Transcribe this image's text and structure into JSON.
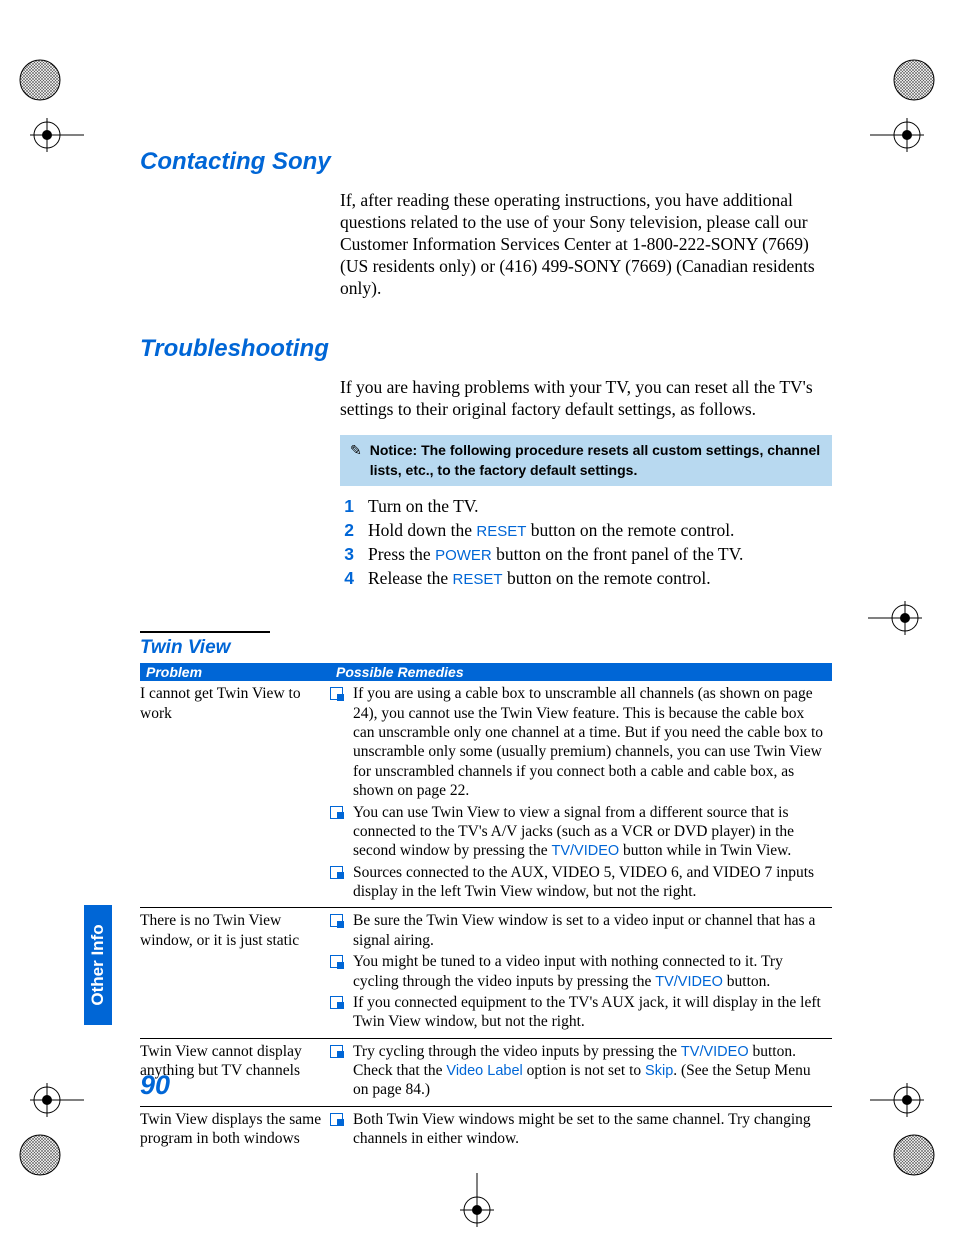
{
  "page_number": "90",
  "side_tab": "Other Info",
  "sections": {
    "contacting": {
      "title": "Contacting Sony",
      "body": "If, after reading these operating instructions, you have additional questions related to the use of your Sony television, please call our Customer Information Services Center at 1-800-222-SONY (7669) (US residents only) or (416) 499-SONY (7669) (Canadian residents only)."
    },
    "troubleshooting": {
      "title": "Troubleshooting",
      "body": "If you are having problems with your TV, you can reset all the TV's settings to their original factory default settings, as follows.",
      "notice": "Notice: The following procedure resets all custom settings, channel lists, etc., to the factory default settings.",
      "steps": [
        {
          "n": "1",
          "pre": "Turn on the TV.",
          "term": "",
          "post": ""
        },
        {
          "n": "2",
          "pre": "Hold down the ",
          "term": "RESET",
          "post": " button on the remote control."
        },
        {
          "n": "3",
          "pre": "Press the ",
          "term": "POWER",
          "post": " button on the front panel of the TV."
        },
        {
          "n": "4",
          "pre": "Release the ",
          "term": "RESET",
          "post": " button on the remote control."
        }
      ]
    }
  },
  "twin_view": {
    "title": "Twin View",
    "headers": {
      "problem": "Problem",
      "remedies": "Possible Remedies"
    },
    "rows": [
      {
        "problem": "I cannot get Twin View to work",
        "remedies": [
          {
            "parts": [
              {
                "t": "If you are using a cable box to unscramble all channels (as shown on page 24), you cannot use the Twin View feature. This is because the cable box can unscramble only one channel at a time. But if you need the cable box to unscramble only some (usually premium) channels, you can use Twin View for unscrambled channels if you connect both a cable and cable box, as shown on page 22."
              }
            ]
          },
          {
            "parts": [
              {
                "t": "You can use Twin View to view a signal from a different source that is connected to the TV's A/V jacks (such as a VCR or DVD player) in the second window by pressing the "
              },
              {
                "term": "TV/VIDEO"
              },
              {
                "t": " button while in Twin View."
              }
            ]
          },
          {
            "parts": [
              {
                "t": "Sources connected to the AUX, VIDEO 5, VIDEO 6, and VIDEO 7 inputs display in the left Twin View window, but not the right."
              }
            ]
          }
        ]
      },
      {
        "problem": "There is no Twin View window, or it is just static",
        "remedies": [
          {
            "parts": [
              {
                "t": "Be sure the Twin View window is set to a video input or channel that has a signal airing."
              }
            ]
          },
          {
            "parts": [
              {
                "t": "You might be tuned to a video input with nothing connected to it. Try cycling through the video inputs by pressing the "
              },
              {
                "term": "TV/VIDEO"
              },
              {
                "t": " button."
              }
            ]
          },
          {
            "parts": [
              {
                "t": "If you connected equipment to the TV's AUX jack, it will display in the left Twin View window, but not the right."
              }
            ]
          }
        ]
      },
      {
        "problem": "Twin View cannot display anything but TV channels",
        "remedies": [
          {
            "parts": [
              {
                "t": "Try cycling through the video inputs by pressing the "
              },
              {
                "term": "TV/VIDEO"
              },
              {
                "t": " button. Check that the "
              },
              {
                "term": "Video Label"
              },
              {
                "t": " option is not set to "
              },
              {
                "term": "Skip"
              },
              {
                "t": ". (See the Setup Menu on page 84.)"
              }
            ]
          }
        ]
      },
      {
        "problem": "Twin View displays the same program in both windows",
        "remedies": [
          {
            "parts": [
              {
                "t": "Both Twin View windows might be set to the same channel. Try changing channels in either window."
              }
            ]
          }
        ]
      }
    ]
  }
}
